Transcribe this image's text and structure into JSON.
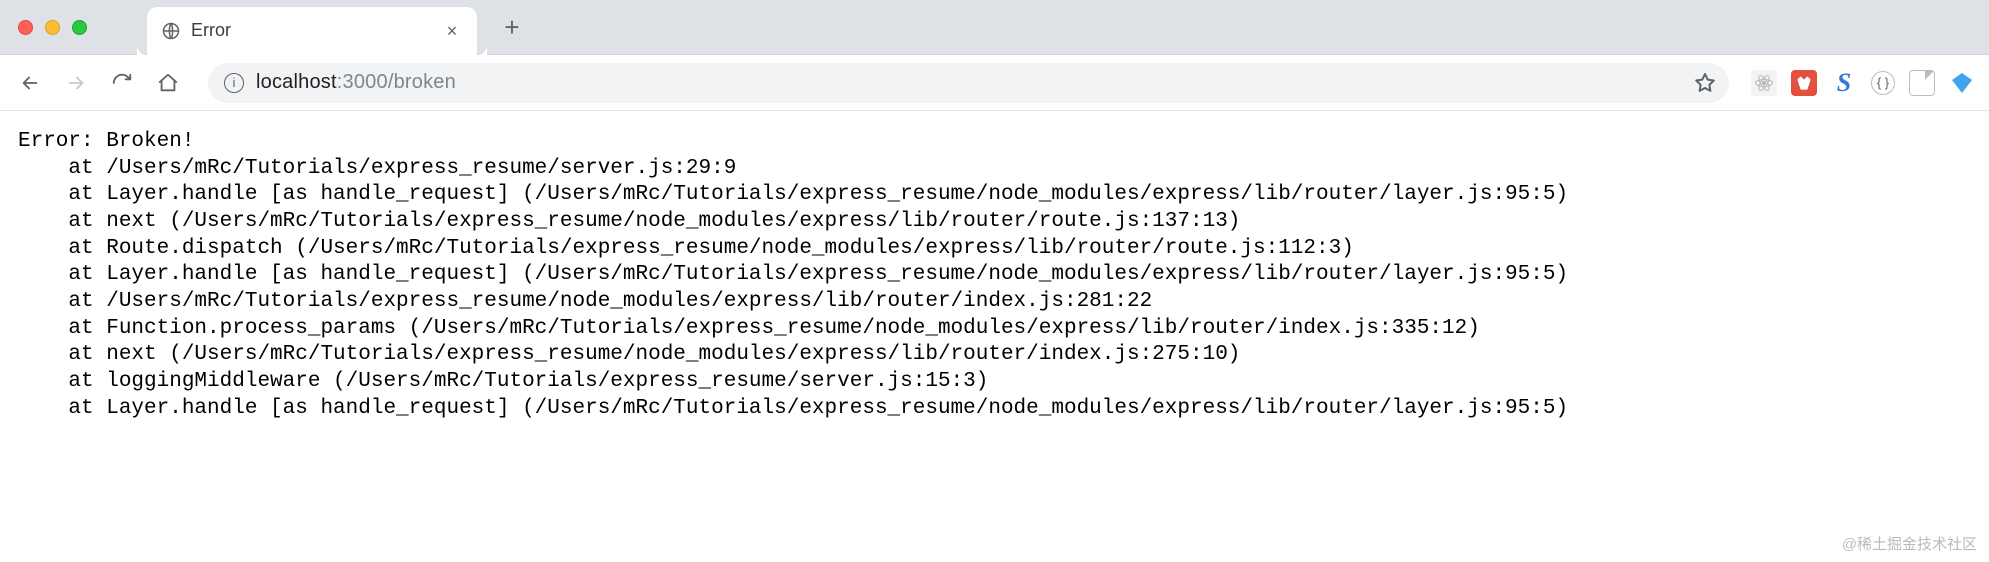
{
  "window": {
    "tab_title": "Error",
    "url_host": "localhost",
    "url_port": ":3000",
    "url_path": "/broken"
  },
  "toolbar": {
    "new_tab_glyph": "+",
    "close_tab_glyph": "×",
    "site_info_glyph": "i",
    "extensions": {
      "react": "react-devtools",
      "red": "meituan",
      "blue_letter": "S",
      "braces_glyph": "{ }"
    }
  },
  "error": {
    "title": "Error: Broken!",
    "stack": [
      "    at /Users/mRc/Tutorials/express_resume/server.js:29:9",
      "    at Layer.handle [as handle_request] (/Users/mRc/Tutorials/express_resume/node_modules/express/lib/router/layer.js:95:5)",
      "    at next (/Users/mRc/Tutorials/express_resume/node_modules/express/lib/router/route.js:137:13)",
      "    at Route.dispatch (/Users/mRc/Tutorials/express_resume/node_modules/express/lib/router/route.js:112:3)",
      "    at Layer.handle [as handle_request] (/Users/mRc/Tutorials/express_resume/node_modules/express/lib/router/layer.js:95:5)",
      "    at /Users/mRc/Tutorials/express_resume/node_modules/express/lib/router/index.js:281:22",
      "    at Function.process_params (/Users/mRc/Tutorials/express_resume/node_modules/express/lib/router/index.js:335:12)",
      "    at next (/Users/mRc/Tutorials/express_resume/node_modules/express/lib/router/index.js:275:10)",
      "    at loggingMiddleware (/Users/mRc/Tutorials/express_resume/server.js:15:3)",
      "    at Layer.handle [as handle_request] (/Users/mRc/Tutorials/express_resume/node_modules/express/lib/router/layer.js:95:5)"
    ]
  },
  "watermark": "@稀土掘金技术社区"
}
